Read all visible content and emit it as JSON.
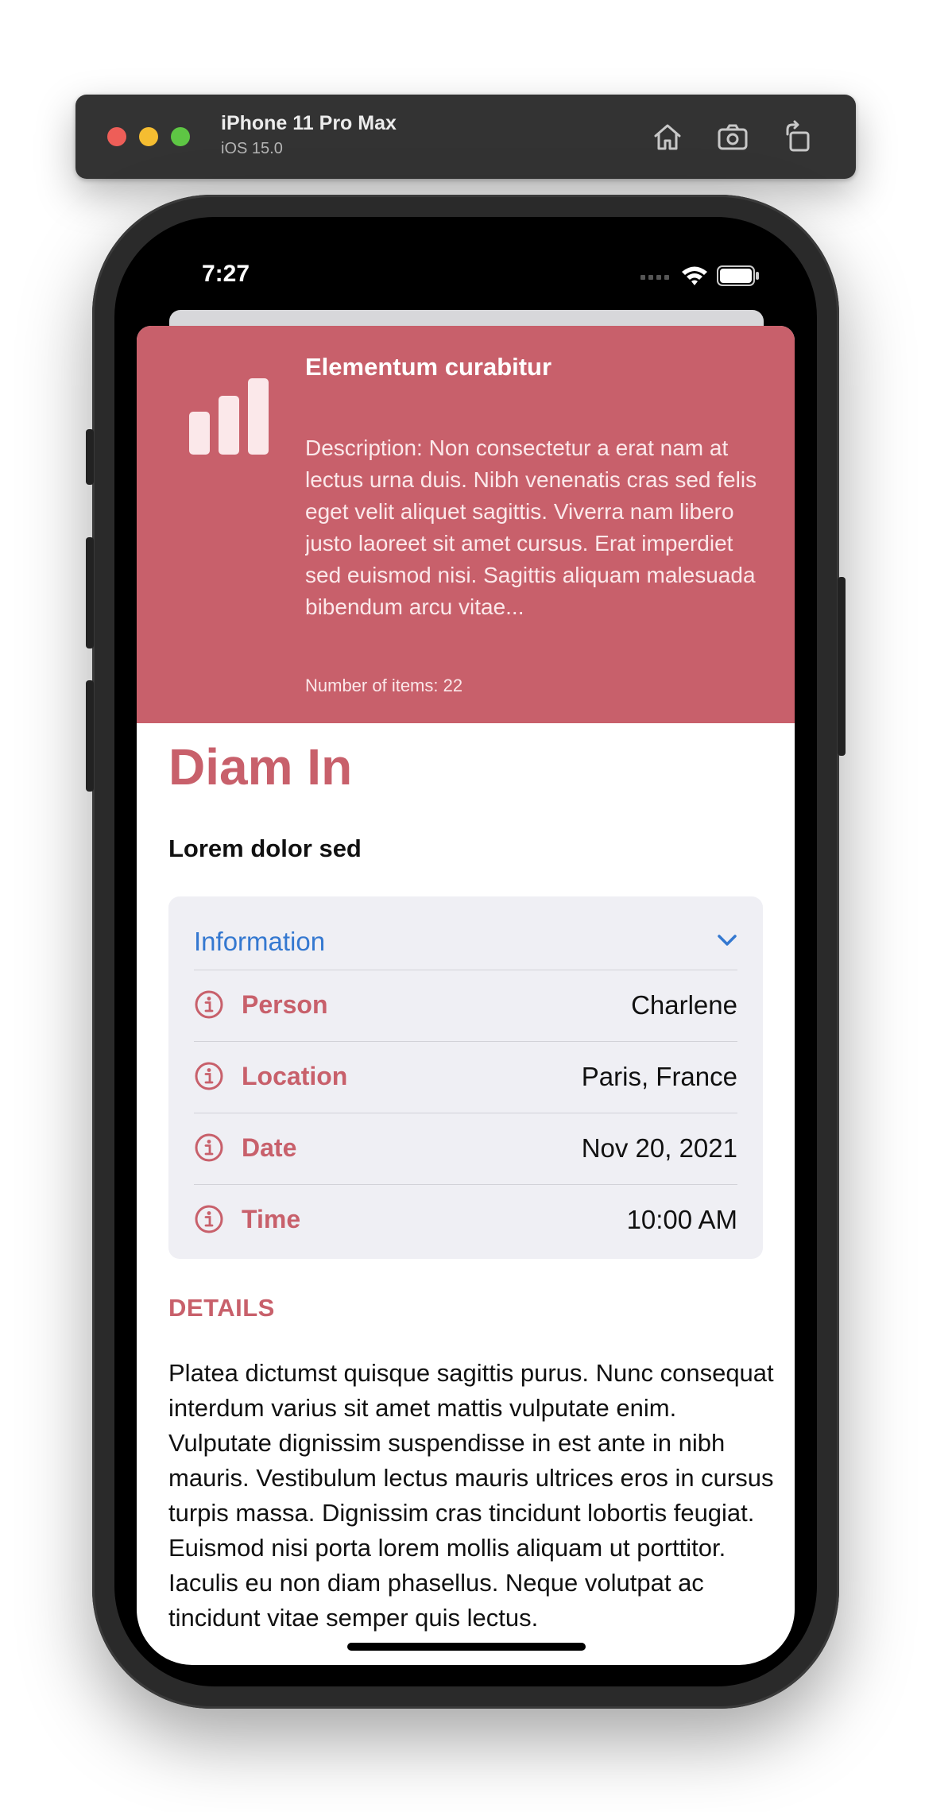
{
  "simulator": {
    "device_name": "iPhone 11 Pro Max",
    "os_version": "iOS 15.0",
    "buttons": [
      "home-icon",
      "screenshot-icon",
      "rotate-icon"
    ]
  },
  "status_bar": {
    "time": "7:27"
  },
  "hero": {
    "title": "Elementum curabitur",
    "description": "Description: Non consectetur a erat nam at lectus urna duis. Nibh venenatis cras sed felis eget velit aliquet sagittis. Viverra nam libero justo laoreet sit amet cursus. Erat imperdiet sed euismod nisi. Sagittis aliquam malesuada bibendum arcu vitae...",
    "count": "Number of items: 22",
    "background": "#c8606b",
    "icon": "chart-bars-icon"
  },
  "page": {
    "title": "Diam In",
    "subtitle": "Lorem dolor sed"
  },
  "info": {
    "header": "Information",
    "accent": "#3478d0",
    "rows": [
      {
        "label": "Person",
        "value": "Charlene"
      },
      {
        "label": "Location",
        "value": "Paris, France"
      },
      {
        "label": "Date",
        "value": "Nov 20, 2021"
      },
      {
        "label": "Time",
        "value": "10:00 AM"
      }
    ]
  },
  "details": {
    "heading": "DETAILS",
    "body": "Platea dictumst quisque sagittis purus. Nunc consequat interdum varius sit amet mattis vulputate enim. Vulputate dignissim suspendisse in est ante in nibh mauris. Vestibulum lectus mauris ultrices eros in cursus turpis massa. Dignissim cras tincidunt lobortis feugiat. Euismod nisi porta lorem mollis aliquam ut porttitor. Iaculis eu non diam phasellus. Neque volutpat ac tincidunt vitae semper quis lectus."
  }
}
